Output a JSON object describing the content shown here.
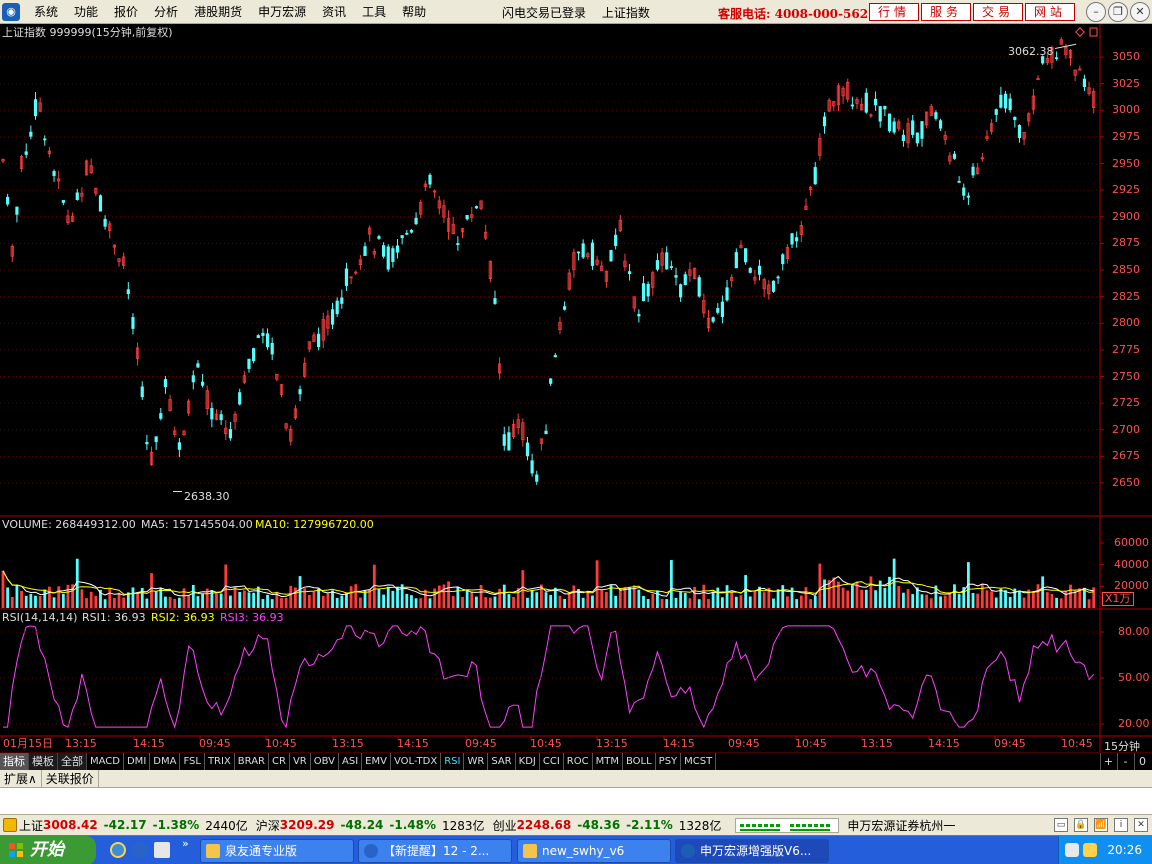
{
  "menubar": {
    "items": [
      "系统",
      "功能",
      "报价",
      "分析",
      "港股期货",
      "申万宏源",
      "资讯",
      "工具",
      "帮助"
    ],
    "status": [
      "闪电交易已登录",
      "上证指数"
    ],
    "hotline": "客服电话: 4008-000-562",
    "quick_buttons": [
      "行情",
      "服务",
      "交易",
      "网站"
    ]
  },
  "chart": {
    "title": "上证指数 999999(15分钟,前复权)",
    "high_label": "3062.38",
    "low_label": "2638.30",
    "price_ticks": [
      "3050",
      "3025",
      "3000",
      "2975",
      "2950",
      "2925",
      "2900",
      "2875",
      "2850",
      "2825",
      "2800",
      "2775",
      "2750",
      "2725",
      "2700",
      "2675",
      "2650"
    ],
    "volume_title": "VOLUME: 268449312.00",
    "volume_ma5": "MA5: 157145504.00",
    "volume_ma10": "MA10: 127996720.00",
    "volume_ticks": [
      "60000",
      "40000",
      "20000"
    ],
    "volume_unit": "X1万",
    "rsi_title": "RSI(14,14,14)",
    "rsi1": "RSI1: 36.93",
    "rsi2": "RSI2: 36.93",
    "rsi3": "RSI3: 36.93",
    "rsi_ticks": [
      "80.00",
      "50.00",
      "20.00"
    ],
    "x_ticks": [
      "01月15日",
      "13:15",
      "14:15",
      "09:45",
      "10:45",
      "13:15",
      "14:15",
      "09:45",
      "10:45",
      "13:15",
      "14:15",
      "09:45",
      "10:45",
      "13:15",
      "14:15",
      "09:45",
      "10:45"
    ],
    "period": "15分钟",
    "colors": {
      "up": "#ff3c3c",
      "down": "#54ffff",
      "rsi": "#ff40ff",
      "ma5": "#ffffff",
      "ma10": "#ffff00",
      "axis": "#b00000"
    }
  },
  "tabs": {
    "main": [
      "指标",
      "模板",
      "全部"
    ],
    "indicators": [
      "MACD",
      "DMI",
      "DMA",
      "FSL",
      "TRIX",
      "BRAR",
      "CR",
      "VR",
      "OBV",
      "ASI",
      "EMV",
      "VOL-TDX",
      "RSI",
      "WR",
      "SAR",
      "KDJ",
      "CCI",
      "ROC",
      "MTM",
      "BOLL",
      "PSY",
      "MCST"
    ],
    "active_indicator": "RSI",
    "controls": [
      "+",
      "-",
      "0"
    ]
  },
  "ext_tabs": [
    "扩展∧",
    "关联报价"
  ],
  "ticker": {
    "items": [
      {
        "name": "上证",
        "value": "3008.42",
        "change": "-42.17",
        "pct": "-1.38%",
        "amount": "2440亿"
      },
      {
        "name": "沪深",
        "value": "3209.29",
        "change": "-48.24",
        "pct": "-1.48%",
        "amount": "1283亿"
      },
      {
        "name": "创业",
        "value": "2248.68",
        "change": "-48.36",
        "pct": "-2.11%",
        "amount": "1328亿"
      }
    ],
    "broker": "申万宏源证券杭州一"
  },
  "taskbar": {
    "start": "开始",
    "tasks": [
      "泉友通专业版",
      "【新提醒】12 - 2...",
      "new_swhy_v6",
      "申万宏源增强版V6..."
    ],
    "clock": "20:26"
  }
}
